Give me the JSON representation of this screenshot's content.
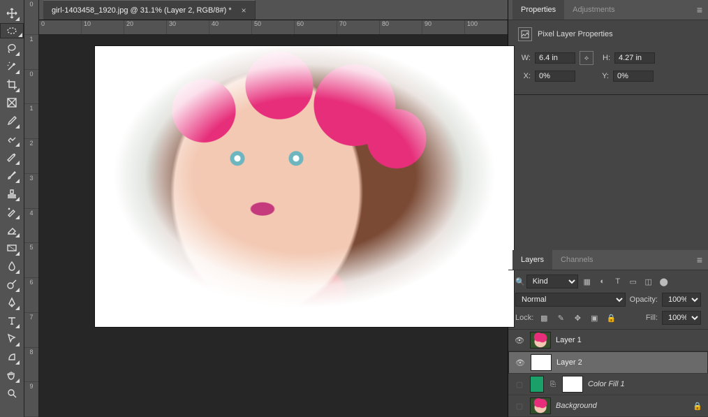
{
  "tab": {
    "title": "girl-1403458_1920.jpg @ 31.1% (Layer 2, RGB/8#) *"
  },
  "hruler": [
    "0",
    "",
    "10",
    "",
    "20",
    "",
    "30",
    "",
    "40",
    "",
    "50",
    "",
    "60",
    "",
    "70",
    "",
    "80",
    "",
    "90",
    "",
    "100"
  ],
  "vruler": [
    "0",
    "",
    "1",
    "",
    "0",
    "",
    "1",
    "",
    "2",
    "",
    "3",
    "",
    "4",
    "",
    "5",
    "",
    "6",
    "",
    "7",
    "",
    "8",
    "",
    "9",
    ""
  ],
  "properties": {
    "tabs": [
      "Properties",
      "Adjustments"
    ],
    "title": "Pixel Layer Properties",
    "w_label": "W:",
    "w": "6.4 in",
    "h_label": "H:",
    "h": "4.27 in",
    "x_label": "X:",
    "x": "0%",
    "y_label": "Y:",
    "y": "0%"
  },
  "layersPanel": {
    "tabs": [
      "Layers",
      "Channels"
    ],
    "kind_label": "Kind",
    "blend": "Normal",
    "opacity_label": "Opacity:",
    "opacity": "100%",
    "lock_label": "Lock:",
    "fill_label": "Fill:",
    "fill": "100%",
    "layers": [
      {
        "name": "Layer 1",
        "visible": true,
        "type": "img"
      },
      {
        "name": "Layer 2",
        "visible": true,
        "type": "white",
        "selected": true
      },
      {
        "name": "Color Fill 1",
        "visible": false,
        "type": "fill"
      },
      {
        "name": "Background",
        "visible": false,
        "type": "bg",
        "locked": true,
        "italic": true
      }
    ]
  },
  "tools": [
    "move",
    "marquee-ellipse",
    "lasso",
    "wand",
    "crop",
    "frame",
    "eyedropper",
    "brush-heal",
    "retouch",
    "brush",
    "stamp",
    "history-brush",
    "eraser",
    "gradient",
    "blur",
    "dodge",
    "pen",
    "type",
    "path-select",
    "rect",
    "hand",
    "zoom"
  ]
}
